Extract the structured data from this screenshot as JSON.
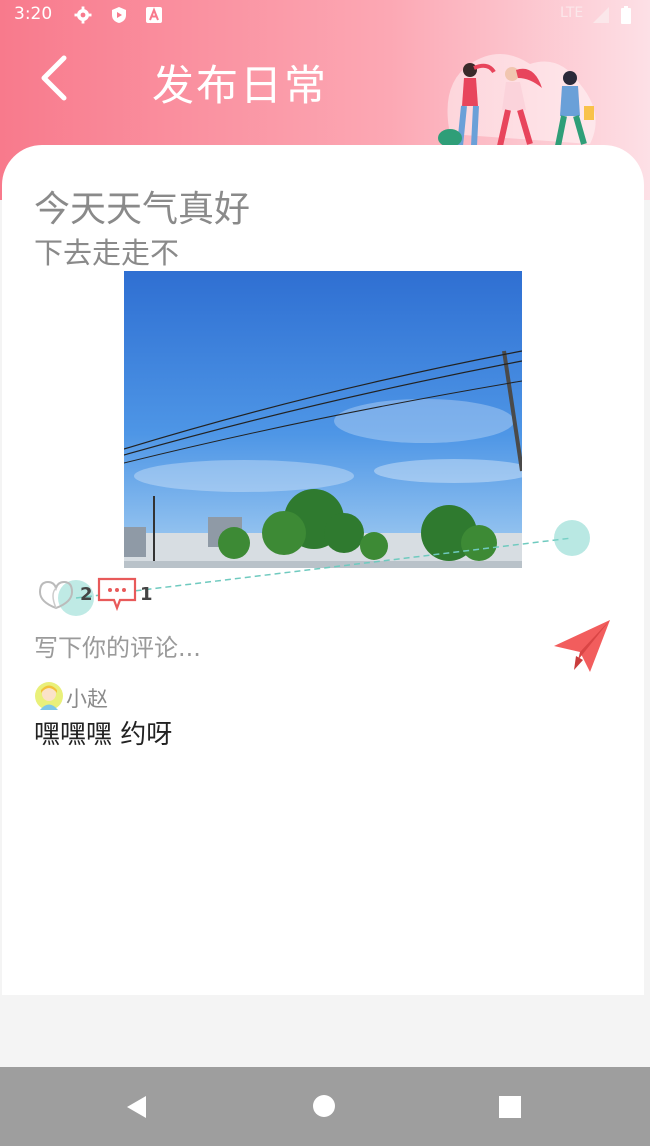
{
  "status_bar": {
    "time": "3:20",
    "network": "LTE",
    "icons": [
      "settings-icon",
      "play-protect-icon",
      "text-a-icon",
      "signal-icon",
      "battery-icon"
    ]
  },
  "header": {
    "title": "发布日常",
    "back_icon": "chevron-left-icon",
    "illustration": "people-walking-illustration"
  },
  "post": {
    "title": "今天天气真好",
    "body": "下去走走不",
    "photo": "blue-sky-trees-power-lines-photo",
    "likes": "2",
    "comments": "1"
  },
  "comment_box": {
    "placeholder": "写下你的评论...",
    "send_icon": "paper-plane-icon"
  },
  "comments": [
    {
      "user": "小赵",
      "text": "嘿嘿嘿 约呀",
      "avatar": "avatar-icon"
    }
  ],
  "colors": {
    "header_start": "#f87a8c",
    "header_end": "#fde0e6",
    "accent": "#f25d5d",
    "teal_decoration": "#7fd6cc"
  }
}
